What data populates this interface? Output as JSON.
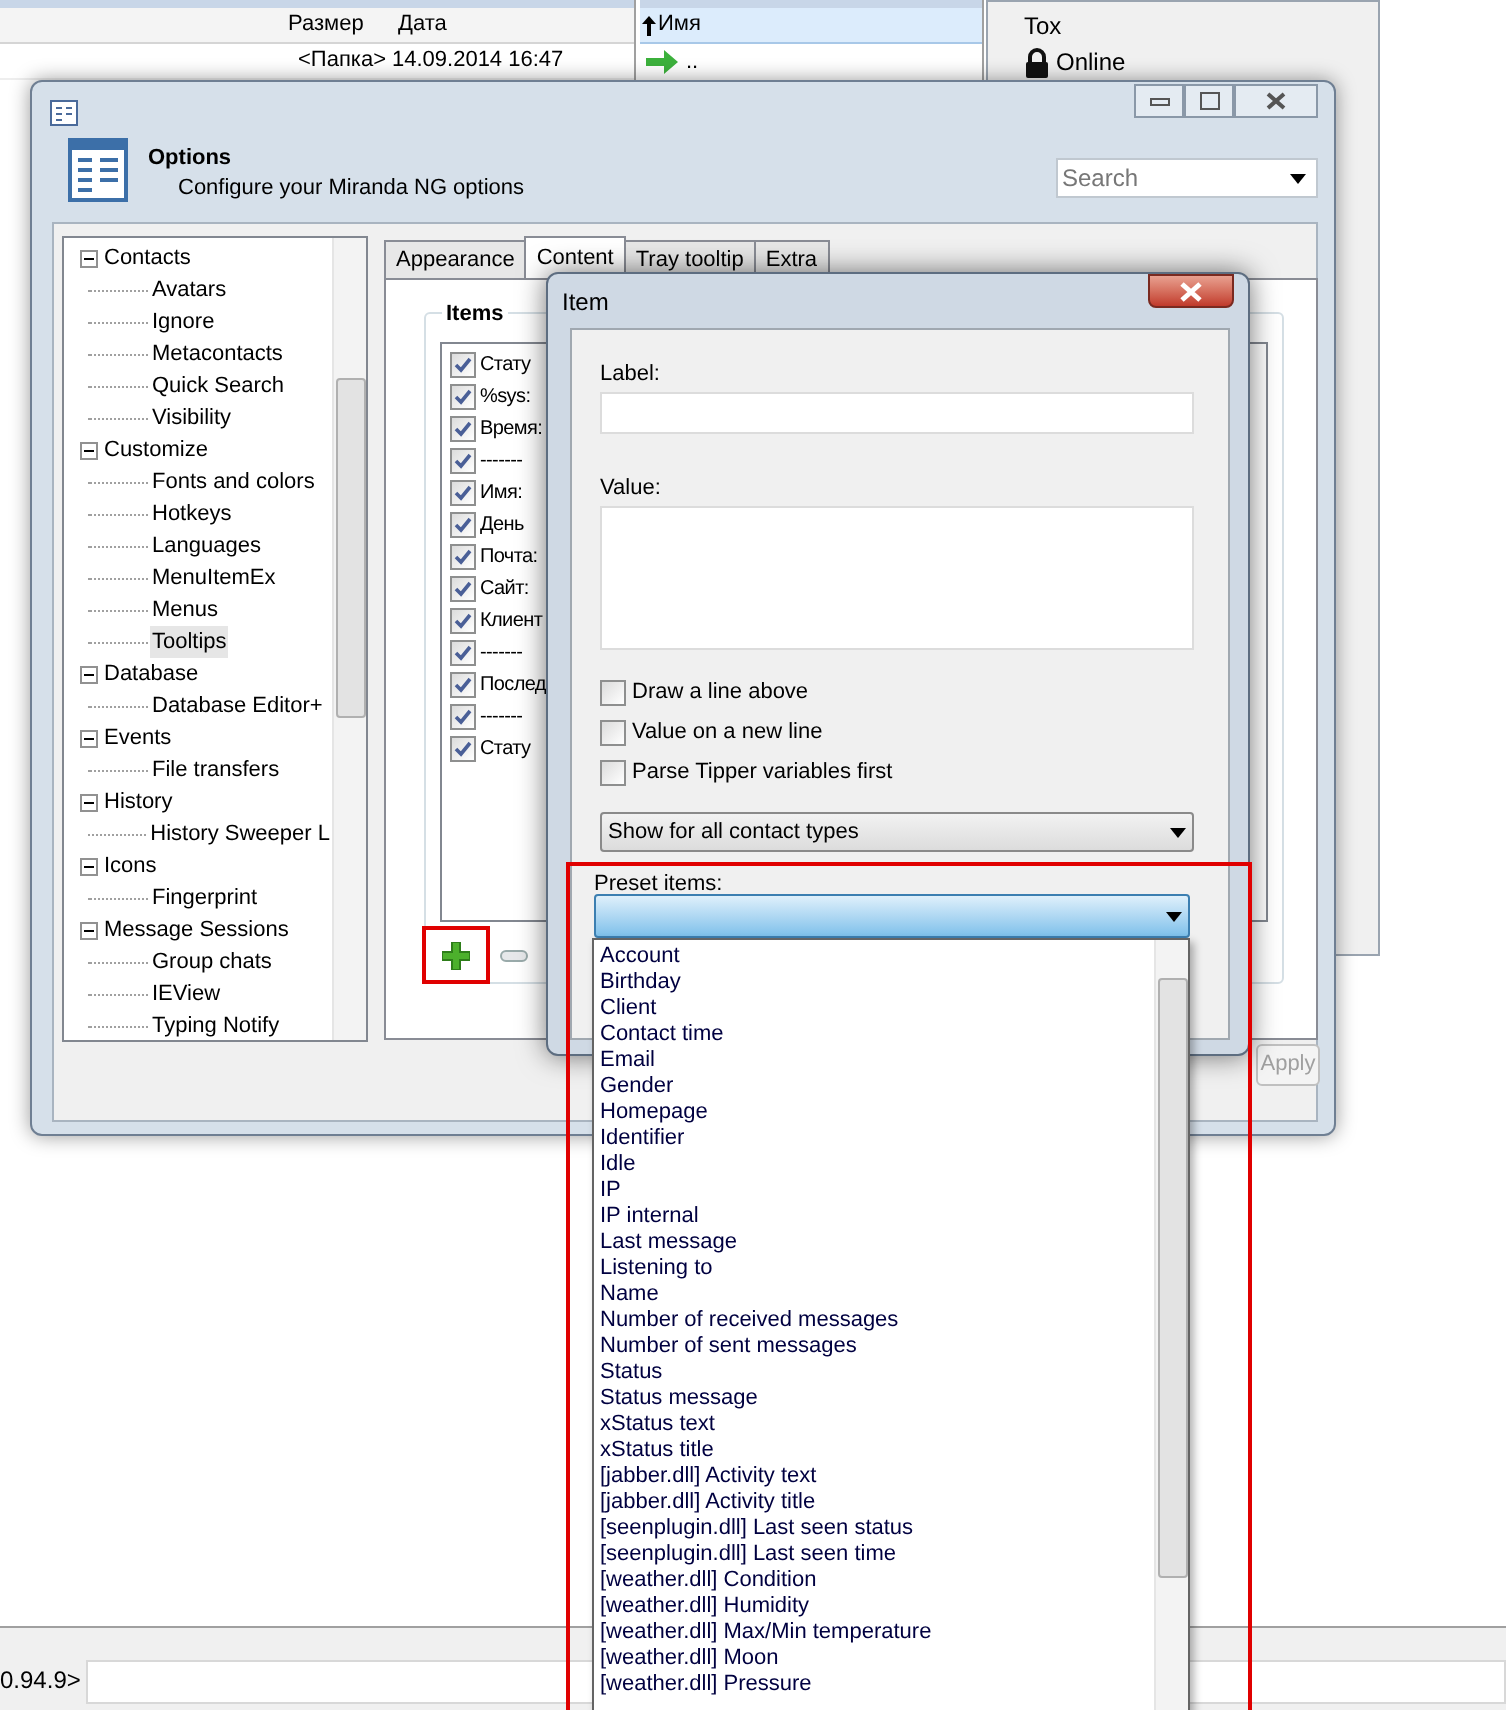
{
  "file_panel": {
    "columns": [
      "Размер",
      "Дата"
    ],
    "rows": [
      {
        "size": "<Папка>",
        "date": "14.09.2014 16:47"
      }
    ]
  },
  "name_panel": {
    "column": "Имя",
    "rows": [
      ".."
    ]
  },
  "contact_list": {
    "account": "Tox",
    "status": "Online"
  },
  "console": {
    "prompt": "0.94.9>"
  },
  "options": {
    "title": "Options",
    "subtitle": "Configure your Miranda NG options",
    "search": {
      "placeholder": "Search"
    },
    "tree": [
      {
        "label": "Contacts",
        "expanded": true,
        "children": [
          {
            "label": "Avatars",
            "selected": false
          },
          {
            "label": "Ignore",
            "selected": false
          },
          {
            "label": "Metacontacts",
            "selected": false
          },
          {
            "label": "Quick Search",
            "selected": false
          },
          {
            "label": "Visibility",
            "selected": false
          }
        ]
      },
      {
        "label": "Customize",
        "expanded": true,
        "children": [
          {
            "label": "Fonts and colors",
            "selected": false
          },
          {
            "label": "Hotkeys",
            "selected": false
          },
          {
            "label": "Languages",
            "selected": false
          },
          {
            "label": "MenuItemEx",
            "selected": false
          },
          {
            "label": "Menus",
            "selected": false
          },
          {
            "label": "Tooltips",
            "selected": true
          }
        ]
      },
      {
        "label": "Database",
        "expanded": true,
        "children": [
          {
            "label": "Database Editor+",
            "selected": false
          }
        ]
      },
      {
        "label": "Events",
        "expanded": true,
        "children": [
          {
            "label": "File transfers",
            "selected": false
          }
        ]
      },
      {
        "label": "History",
        "expanded": true,
        "children": [
          {
            "label": "History Sweeper L",
            "selected": false
          }
        ]
      },
      {
        "label": "Icons",
        "expanded": true,
        "children": [
          {
            "label": "Fingerprint",
            "selected": false
          }
        ]
      },
      {
        "label": "Message Sessions",
        "expanded": true,
        "children": [
          {
            "label": "Group chats",
            "selected": false
          },
          {
            "label": "IEView",
            "selected": false
          },
          {
            "label": "Typing Notify",
            "selected": false
          }
        ]
      }
    ],
    "tabs": [
      {
        "label": "Appearance",
        "selected": false
      },
      {
        "label": "Content",
        "selected": true
      },
      {
        "label": "Tray tooltip",
        "selected": false
      },
      {
        "label": "Extra",
        "selected": false
      }
    ],
    "items_group": {
      "title": "Items",
      "items": [
        {
          "text": "Стату",
          "checked": true
        },
        {
          "text": "%sys:",
          "checked": true
        },
        {
          "text": "Время:",
          "checked": true
        },
        {
          "text": "-------",
          "checked": true
        },
        {
          "text": "Имя:",
          "checked": true
        },
        {
          "text": "День",
          "checked": true
        },
        {
          "text": "Почта:",
          "checked": true
        },
        {
          "text": "Сайт:",
          "checked": true
        },
        {
          "text": "Клиент",
          "checked": true
        },
        {
          "text": "-------",
          "checked": true
        },
        {
          "text": "Послед",
          "checked": true
        },
        {
          "text": "-------",
          "checked": true
        },
        {
          "text": "Стату",
          "checked": true
        }
      ]
    },
    "apply": {
      "label": "Apply",
      "disabled": true
    }
  },
  "item_dialog": {
    "title": "Item",
    "label_field": {
      "label": "Label:"
    },
    "value_field": {
      "label": "Value:"
    },
    "options": [
      {
        "label": "Draw a line above",
        "checked": false
      },
      {
        "label": "Value on a new line",
        "checked": false
      },
      {
        "label": "Parse Tipper variables first",
        "checked": false
      }
    ],
    "contact_types": "Show for all contact types",
    "preset": {
      "label": "Preset items:",
      "items": [
        "Account",
        "Birthday",
        "Client",
        "Contact time",
        "Email",
        "Gender",
        "Homepage",
        "Identifier",
        "Idle",
        "IP",
        "IP internal",
        "Last message",
        "Listening to",
        "Name",
        "Number of received messages",
        "Number of sent messages",
        "Status",
        "Status message",
        "xStatus text",
        "xStatus title",
        "[jabber.dll] Activity text",
        "[jabber.dll] Activity title",
        "[seenplugin.dll] Last seen status",
        "[seenplugin.dll] Last seen time",
        "[weather.dll] Condition",
        "[weather.dll] Humidity",
        "[weather.dll] Max/Min temperature",
        "[weather.dll] Moon",
        "[weather.dll] Pressure"
      ]
    }
  }
}
